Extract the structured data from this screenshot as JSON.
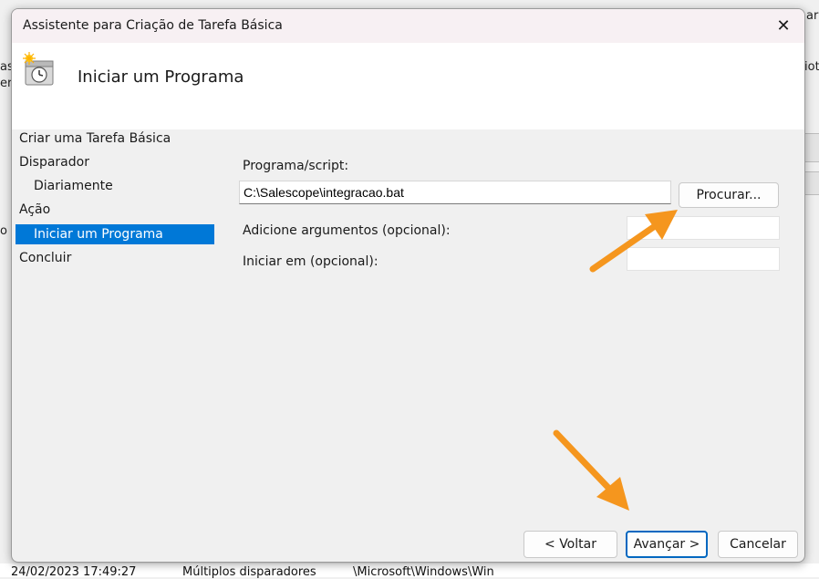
{
  "dialog": {
    "title": "Assistente para Criação de Tarefa Básica",
    "close_symbol": "✕",
    "header_title": "Iniciar um Programa"
  },
  "nav": {
    "items": [
      {
        "label": "Criar uma Tarefa Básica"
      },
      {
        "label": "Disparador"
      },
      {
        "label": "Diariamente"
      },
      {
        "label": "Ação"
      },
      {
        "label": "Iniciar um Programa"
      },
      {
        "label": "Concluir"
      }
    ],
    "selected_index": 4
  },
  "form": {
    "program_label": "Programa/script:",
    "program_value": "C:\\Salescope\\integracao.bat",
    "browse_label": "Procurar...",
    "args_label": "Adicione argumentos (opcional):",
    "args_value": "",
    "start_in_label": "Iniciar em (opcional):",
    "start_in_value": ""
  },
  "buttons": {
    "back": "< Voltar",
    "next": "Avançar >",
    "cancel": "Cancelar"
  },
  "background": {
    "right_top": "ar,",
    "right_mid": "iot",
    "left_a": "as",
    "left_b": "er",
    "left_c": "o",
    "row": [
      "24/02/2023 17:49:27",
      "Múltiplos disparadores",
      "\\Microsoft\\Windows\\Win"
    ]
  },
  "annotations": {
    "arrow_color": "#f5961e"
  }
}
